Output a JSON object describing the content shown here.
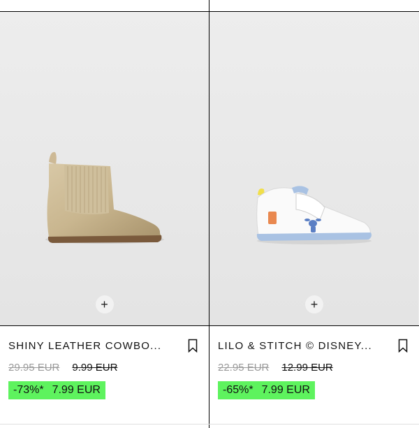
{
  "products": [
    {
      "name": "SHINY LEATHER COWBO...",
      "price_original": "29.95 EUR",
      "price_previous": "9.99 EUR",
      "discount": "-73%*",
      "price_current": "7.99 EUR",
      "image_icon": "cowboy-boot-image",
      "quick_add_symbol": "+"
    },
    {
      "name": "LILO & STITCH © DISNEY...",
      "price_original": "22.95 EUR",
      "price_previous": "12.99 EUR",
      "discount": "-65%*",
      "price_current": "7.99 EUR",
      "image_icon": "sneaker-image",
      "quick_add_symbol": "+"
    }
  ],
  "colors": {
    "sale_highlight": "#5ef35e",
    "image_background": "#ebebeb",
    "muted_price": "#9a9a9a"
  }
}
